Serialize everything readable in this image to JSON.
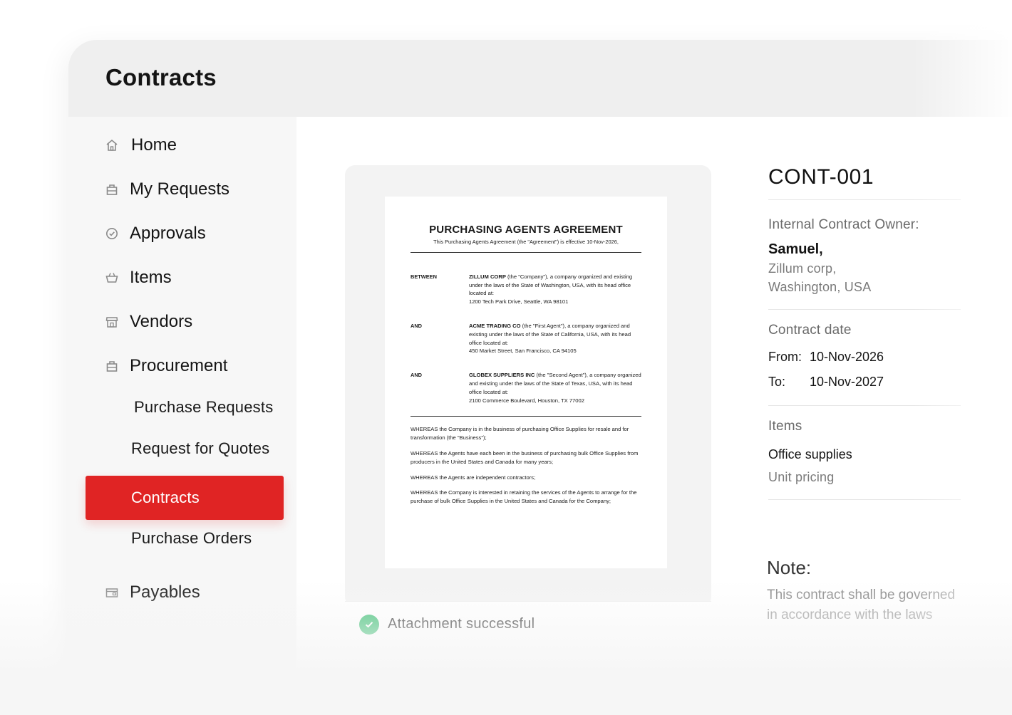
{
  "app": {
    "title": "Contracts"
  },
  "sidebar": {
    "items": [
      {
        "label": "Home",
        "icon": "home-icon"
      },
      {
        "label": "My Requests",
        "icon": "bag-icon"
      },
      {
        "label": "Approvals",
        "icon": "check-circle-icon"
      },
      {
        "label": "Items",
        "icon": "basket-icon"
      },
      {
        "label": "Vendors",
        "icon": "store-icon"
      },
      {
        "label": "Procurement",
        "icon": "bag-icon"
      },
      {
        "label": "Payables",
        "icon": "wallet-icon"
      }
    ],
    "sub_items": [
      {
        "label": "Purchase Requests"
      },
      {
        "label": "Request for Quotes"
      },
      {
        "label": "Contracts",
        "active": true
      },
      {
        "label": "Purchase Orders"
      }
    ],
    "accent_color": "#e02424"
  },
  "document": {
    "title": "PURCHASING AGENTS AGREEMENT",
    "subtitle": "This Purchasing Agents Agreement (the \"Agreement\") is effective 10-Nov-2026,",
    "parties": [
      {
        "tag": "BETWEEN",
        "name": "ZILLUM CORP",
        "text": " (the \"Company\"), a company organized and existing under the laws of the State of Washington, USA, with its head office located at:",
        "address": "1200 Tech Park Drive, Seattle, WA 98101"
      },
      {
        "tag": "AND",
        "name": "ACME TRADING CO",
        "text": " (the \"First Agent\"), a company organized and existing under the laws of the State of California, USA, with its head office located at:",
        "address": "450 Market Street, San Francisco, CA 94105"
      },
      {
        "tag": "AND",
        "name": "GLOBEX SUPPLIERS INC",
        "text": " (the \"Second Agent\"), a company organized and existing under the laws of the State of Texas, USA, with its head office located at:",
        "address": "2100 Commerce Boulevard, Houston, TX 77002"
      }
    ],
    "whereas": [
      "WHEREAS the Company is in the business of purchasing Office Supplies for resale and for transformation (the \"Business\");",
      "WHEREAS the Agents have each been in the business of purchasing bulk Office Supplies from producers in the United States and Canada for many years;",
      "WHEREAS the Agents are independent contractors;",
      "WHEREAS the Company is interested in retaining the services of the Agents to arrange for the purchase of bulk Office Supplies in the United States and Canada for the Company;"
    ]
  },
  "attachment": {
    "status": "Attachment successful",
    "status_color": "#3cbf74"
  },
  "details": {
    "contract_id": "CONT-001",
    "owner_label": "Internal Contract Owner:",
    "owner_name": "Samuel,",
    "owner_company": "Zillum corp,",
    "owner_location": "Washington, USA",
    "date_label": "Contract date",
    "from_label": "From:",
    "from_value": "10-Nov-2026",
    "to_label": "To:",
    "to_value": "10-Nov-2027",
    "items_label": "Items",
    "item_name": "Office supplies",
    "item_pricing": "Unit pricing",
    "note_label": "Note:",
    "note_line1": "This contract shall be governed",
    "note_line2": "in accordance with the laws"
  }
}
